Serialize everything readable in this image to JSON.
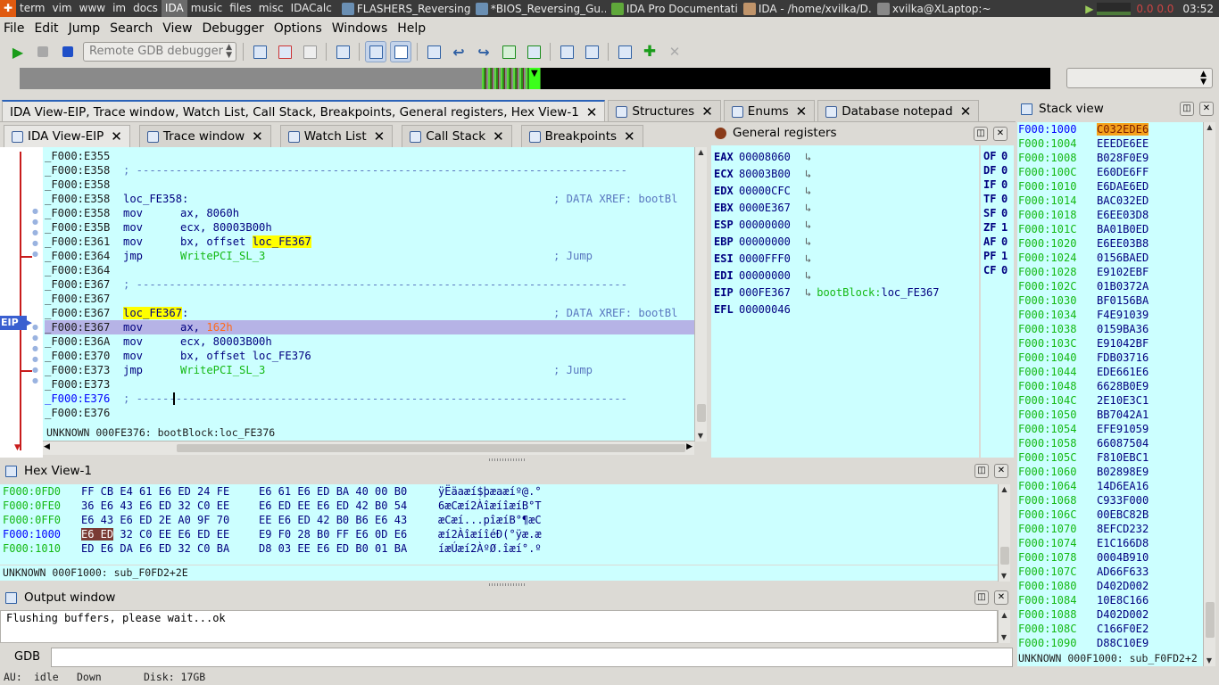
{
  "taskbar": {
    "workspaces": [
      "term",
      "vim",
      "www",
      "im",
      "docs",
      "IDA",
      "music",
      "files",
      "misc",
      "IDACalc"
    ],
    "active_workspace": "IDA",
    "tasks": [
      "FLASHERS_Reversing...",
      "*BIOS_Reversing_Gu...",
      "IDA Pro Documentation",
      "IDA - /home/xvilka/D...",
      "xvilka@XLaptop:~"
    ],
    "cpu": "0.0 0.0",
    "clock": "03:52"
  },
  "menu": [
    "File",
    "Edit",
    "Jump",
    "Search",
    "View",
    "Debugger",
    "Options",
    "Windows",
    "Help"
  ],
  "toolbar": {
    "debugger_select": "Remote GDB debugger"
  },
  "top_tabs": [
    {
      "label": "IDA View-EIP, Trace window, Watch List, Call Stack, Breakpoints, General registers, Hex View-1",
      "selected": true
    },
    {
      "label": "Structures",
      "selected": false
    },
    {
      "label": "Enums",
      "selected": false
    },
    {
      "label": "Database notepad",
      "selected": false
    }
  ],
  "sub_tabs": [
    "IDA View-EIP",
    "Trace window",
    "Watch List",
    "Call Stack",
    "Breakpoints"
  ],
  "eip_marker": "EIP",
  "disasm": [
    {
      "addr": "_F000:E355",
      "t": "blank"
    },
    {
      "addr": "_F000:E358",
      "t": "sep",
      "text": "; ---------------------------------------------------------------------------"
    },
    {
      "addr": "_F000:E358",
      "t": "blank"
    },
    {
      "addr": "_F000:E358",
      "t": "label",
      "label": "loc_FE358:",
      "cmt": "; DATA XREF: bootBl"
    },
    {
      "addr": "_F000:E358",
      "t": "ins",
      "mn": "mov",
      "op": "ax, 8060h"
    },
    {
      "addr": "_F000:E35B",
      "t": "ins",
      "mn": "mov",
      "op": "ecx, 80003B00h"
    },
    {
      "addr": "_F000:E361",
      "t": "insref",
      "mn": "mov",
      "op": "bx, offset ",
      "ref": "loc_FE367"
    },
    {
      "addr": "_F000:E364",
      "t": "jmp",
      "mn": "jmp",
      "fn": "WritePCI_SL_3",
      "cmt": "; Jump"
    },
    {
      "addr": "_F000:E364",
      "t": "blank"
    },
    {
      "addr": "_F000:E367",
      "t": "sep",
      "text": "; ---------------------------------------------------------------------------"
    },
    {
      "addr": "_F000:E367",
      "t": "blank"
    },
    {
      "addr": "_F000:E367",
      "t": "labelhl",
      "label": "loc_FE367",
      "suffix": ":",
      "cmt": "; DATA XREF: bootBl"
    },
    {
      "addr": "_F000:E367",
      "t": "eip",
      "mn": "mov",
      "op": "ax, ",
      "num": "162h"
    },
    {
      "addr": "_F000:E36A",
      "t": "ins",
      "mn": "mov",
      "op": "ecx, 80003B00h"
    },
    {
      "addr": "_F000:E370",
      "t": "ins",
      "mn": "mov",
      "op": "bx, offset loc_FE376"
    },
    {
      "addr": "_F000:E373",
      "t": "jmp",
      "mn": "jmp",
      "fn": "WritePCI_SL_3",
      "cmt": "; Jump"
    },
    {
      "addr": "_F000:E373",
      "t": "blank"
    },
    {
      "addr": "_F000:E376",
      "t": "sepcur",
      "text": "; ---------------------------------------------------------------------------"
    },
    {
      "addr": "_F000:E376",
      "t": "blank"
    }
  ],
  "disasm_status": "UNKNOWN 000FE376: bootBlock:loc_FE376",
  "registers_title": "General registers",
  "registers": [
    {
      "name": "EAX",
      "value": "00008060"
    },
    {
      "name": "ECX",
      "value": "80003B00"
    },
    {
      "name": "EDX",
      "value": "00000CFC"
    },
    {
      "name": "EBX",
      "value": "0000E367"
    },
    {
      "name": "ESP",
      "value": "00000000"
    },
    {
      "name": "EBP",
      "value": "00000000"
    },
    {
      "name": "ESI",
      "value": "0000FFF0"
    },
    {
      "name": "EDI",
      "value": "00000000"
    },
    {
      "name": "EIP",
      "value": "000FE367",
      "target_seg": "bootBlock:",
      "target": "loc_FE367"
    },
    {
      "name": "EFL",
      "value": "00000046"
    }
  ],
  "flags": [
    {
      "name": "OF",
      "value": "0"
    },
    {
      "name": "DF",
      "value": "0"
    },
    {
      "name": "IF",
      "value": "0"
    },
    {
      "name": "TF",
      "value": "0"
    },
    {
      "name": "SF",
      "value": "0"
    },
    {
      "name": "ZF",
      "value": "1"
    },
    {
      "name": "AF",
      "value": "0"
    },
    {
      "name": "PF",
      "value": "1"
    },
    {
      "name": "CF",
      "value": "0"
    }
  ],
  "stack_title": "Stack view",
  "stack": [
    {
      "a": "F000:1000",
      "v": "C032EDE6"
    },
    {
      "a": "F000:1004",
      "v": "EEEDE6EE"
    },
    {
      "a": "F000:1008",
      "v": "B028F0E9"
    },
    {
      "a": "F000:100C",
      "v": "E60DE6FF"
    },
    {
      "a": "F000:1010",
      "v": "E6DAE6ED"
    },
    {
      "a": "F000:1014",
      "v": "BAC032ED"
    },
    {
      "a": "F000:1018",
      "v": "E6EE03D8"
    },
    {
      "a": "F000:101C",
      "v": "BA01B0ED"
    },
    {
      "a": "F000:1020",
      "v": "E6EE03B8"
    },
    {
      "a": "F000:1024",
      "v": "0156BAED"
    },
    {
      "a": "F000:1028",
      "v": "E9102EBF"
    },
    {
      "a": "F000:102C",
      "v": "01B0372A"
    },
    {
      "a": "F000:1030",
      "v": "BF0156BA"
    },
    {
      "a": "F000:1034",
      "v": "F4E91039"
    },
    {
      "a": "F000:1038",
      "v": "0159BA36"
    },
    {
      "a": "F000:103C",
      "v": "E91042BF"
    },
    {
      "a": "F000:1040",
      "v": "FDB03716"
    },
    {
      "a": "F000:1044",
      "v": "EDE661E6"
    },
    {
      "a": "F000:1048",
      "v": "6628B0E9"
    },
    {
      "a": "F000:104C",
      "v": "2E10E3C1"
    },
    {
      "a": "F000:1050",
      "v": "BB7042A1"
    },
    {
      "a": "F000:1054",
      "v": "EFE91059"
    },
    {
      "a": "F000:1058",
      "v": "66087504"
    },
    {
      "a": "F000:105C",
      "v": "F810EBC1"
    },
    {
      "a": "F000:1060",
      "v": "B02898E9"
    },
    {
      "a": "F000:1064",
      "v": "14D6EA16"
    },
    {
      "a": "F000:1068",
      "v": "C933F000"
    },
    {
      "a": "F000:106C",
      "v": "00EBC82B"
    },
    {
      "a": "F000:1070",
      "v": "8EFCD232"
    },
    {
      "a": "F000:1074",
      "v": "E1C166D8"
    },
    {
      "a": "F000:1078",
      "v": "0004B910"
    },
    {
      "a": "F000:107C",
      "v": "AD66F633"
    },
    {
      "a": "F000:1080",
      "v": "D402D002"
    },
    {
      "a": "F000:1084",
      "v": "10E8C166"
    },
    {
      "a": "F000:1088",
      "v": "D402D002"
    },
    {
      "a": "F000:108C",
      "v": "C166F0E2"
    },
    {
      "a": "F000:1090",
      "v": "D88C10E9"
    }
  ],
  "stack_status": "UNKNOWN 000F1000: sub_F0FD2+2",
  "hex_title": "Hex View-1",
  "hex": [
    {
      "a": "F000:0FD0",
      "b1": "FF CB E4 61 E6 ED 24 FE",
      "b2": "E6 61 E6 ED BA 40 00 B0",
      "asc": "ÿËäaæí$þæaæíº@.°"
    },
    {
      "a": "F000:0FE0",
      "b1": "36 E6 43 E6 ED 32 C0 EE",
      "b2": "E6 ED EE E6 ED 42 B0 54",
      "asc": "6æCæí2ÀîæíîæíB°T"
    },
    {
      "a": "F000:0FF0",
      "b1": "E6 43 E6 ED 2E A0 9F 70",
      "b2": "EE E6 ED 42 B0 B6 E6 43",
      "asc": "æCæí...pîæíB°¶æC"
    },
    {
      "a": "F000:1000",
      "b1sel": "E6 ED",
      "b1": " 32 C0 EE E6 ED EE",
      "b2": "E9 F0 28 B0 FF E6 0D E6",
      "asc": "æí2ÀîæíîéÐ(°ÿæ.æ",
      "cur": true
    },
    {
      "a": "F000:1010",
      "b1": "ED E6 DA E6 ED 32 C0 BA",
      "b2": "D8 03 EE E6 ED B0 01 BA",
      "asc": "íæÚæí2ÀºØ.îæí°.º"
    }
  ],
  "hex_status": "UNKNOWN 000F1000: sub_F0FD2+2E",
  "output_title": "Output window",
  "output_text": "Flushing buffers, please wait...ok",
  "gdb_label": "GDB",
  "statusbar": {
    "au": "AU:",
    "state": "idle",
    "dir": "Down",
    "disk": "Disk: 17GB"
  }
}
